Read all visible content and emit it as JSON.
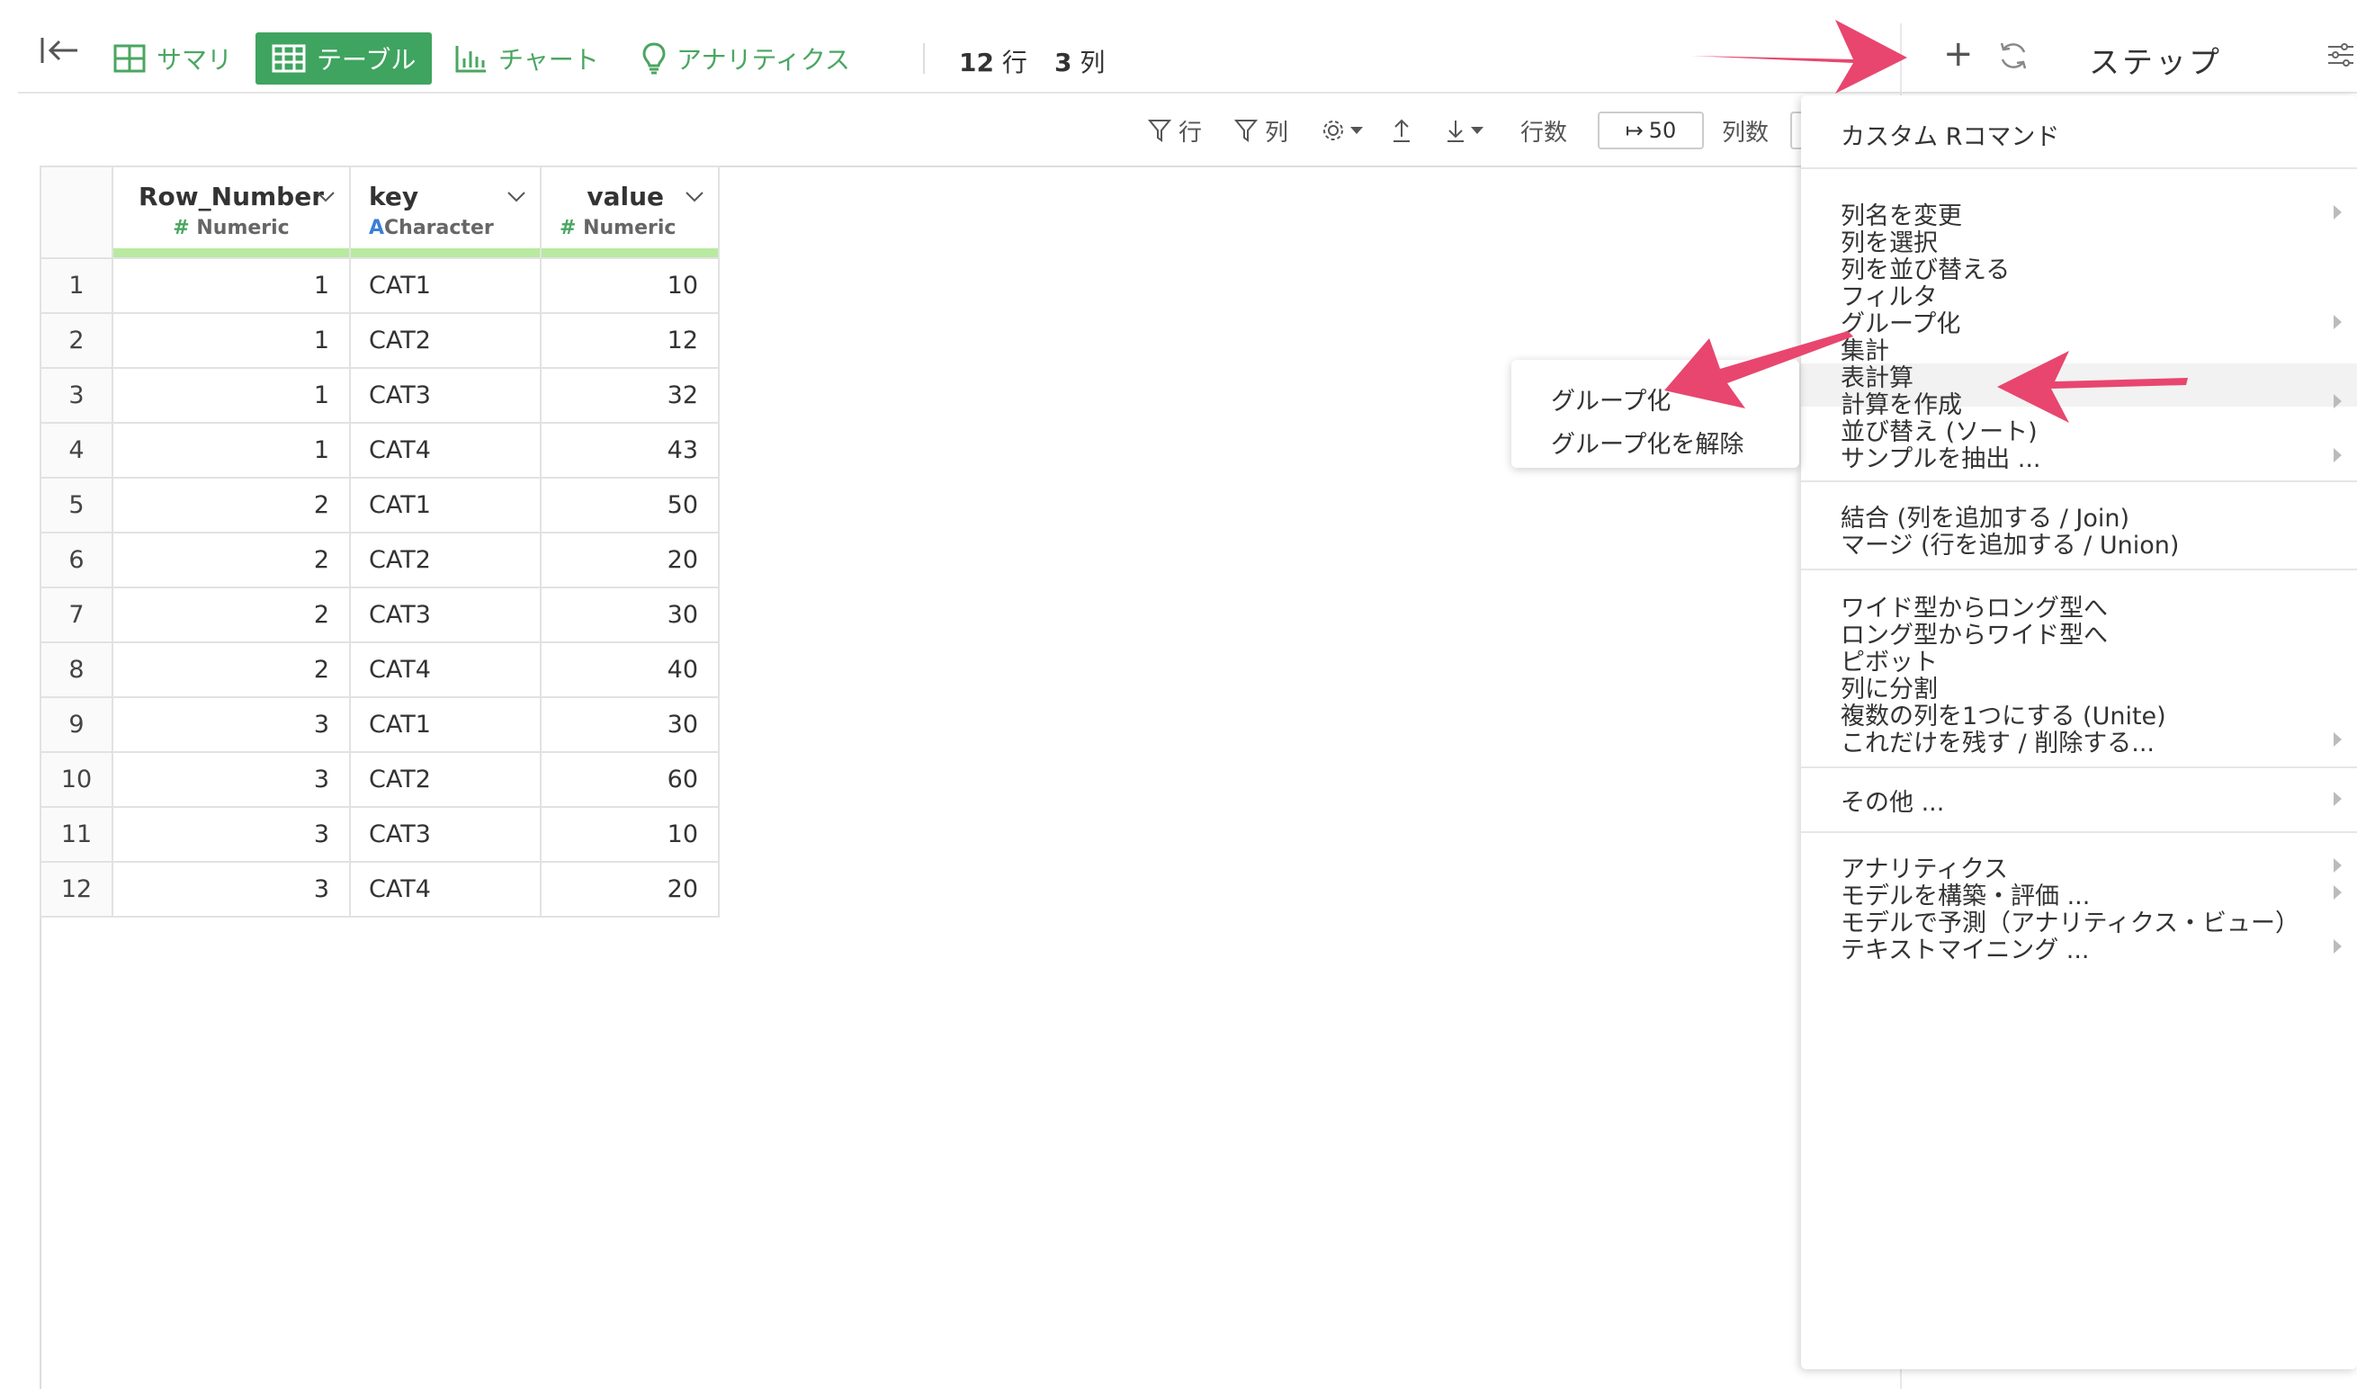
{
  "toolbar": {
    "tabs": [
      {
        "label": "サマリ",
        "icon": "grid-icon"
      },
      {
        "label": "テーブル",
        "icon": "table-icon",
        "active": true
      },
      {
        "label": "チャート",
        "icon": "bar-chart-icon"
      },
      {
        "label": "アナリティクス",
        "icon": "lightbulb-icon"
      }
    ],
    "rows_count": "12",
    "rows_unit": "行",
    "cols_count": "3",
    "cols_unit": "列",
    "steps_label": "ステップ",
    "accent": "#3fa45f"
  },
  "subtoolbar": {
    "filter_rows": "行",
    "filter_cols": "列",
    "rows_label": "行数",
    "rows_value": "50",
    "cols_label": "列数"
  },
  "table": {
    "columns": [
      {
        "name": "Row_Number",
        "type": "Numeric",
        "type_icon": "#"
      },
      {
        "name": "key",
        "type": "Character",
        "type_icon": "A"
      },
      {
        "name": "value",
        "type": "Numeric",
        "type_icon": "#"
      }
    ],
    "rows": [
      [
        "1",
        "1",
        "CAT1",
        "10"
      ],
      [
        "2",
        "1",
        "CAT2",
        "12"
      ],
      [
        "3",
        "1",
        "CAT3",
        "32"
      ],
      [
        "4",
        "1",
        "CAT4",
        "43"
      ],
      [
        "5",
        "2",
        "CAT1",
        "50"
      ],
      [
        "6",
        "2",
        "CAT2",
        "20"
      ],
      [
        "7",
        "2",
        "CAT3",
        "30"
      ],
      [
        "8",
        "2",
        "CAT4",
        "40"
      ],
      [
        "9",
        "3",
        "CAT1",
        "30"
      ],
      [
        "10",
        "3",
        "CAT2",
        "60"
      ],
      [
        "11",
        "3",
        "CAT3",
        "10"
      ],
      [
        "12",
        "3",
        "CAT4",
        "20"
      ]
    ]
  },
  "step_menu": {
    "items": [
      "カスタム Rコマンド",
      "列名を変更",
      "列を選択",
      "列を並び替える",
      "フィルタ",
      "グループ化",
      "集計",
      "表計算",
      "計算を作成",
      "並び替え (ソート)",
      "サンプルを抽出 ...",
      "結合 (列を追加する / Join)",
      "マージ (行を追加する / Union)",
      "ワイド型からロング型へ",
      "ロング型からワイド型へ",
      "ピボット",
      "列に分割",
      "複数の列を1つにする (Unite)",
      "これだけを残す / 削除する...",
      "その他 ...",
      "アナリティクス",
      "モデルを構築・評価 ...",
      "モデルで予測（アナリティクス・ビュー）",
      "テキストマイニング ..."
    ]
  },
  "submenu": {
    "items": [
      "グループ化",
      "グループ化を解除"
    ]
  },
  "annotation_color": "#e8466e"
}
